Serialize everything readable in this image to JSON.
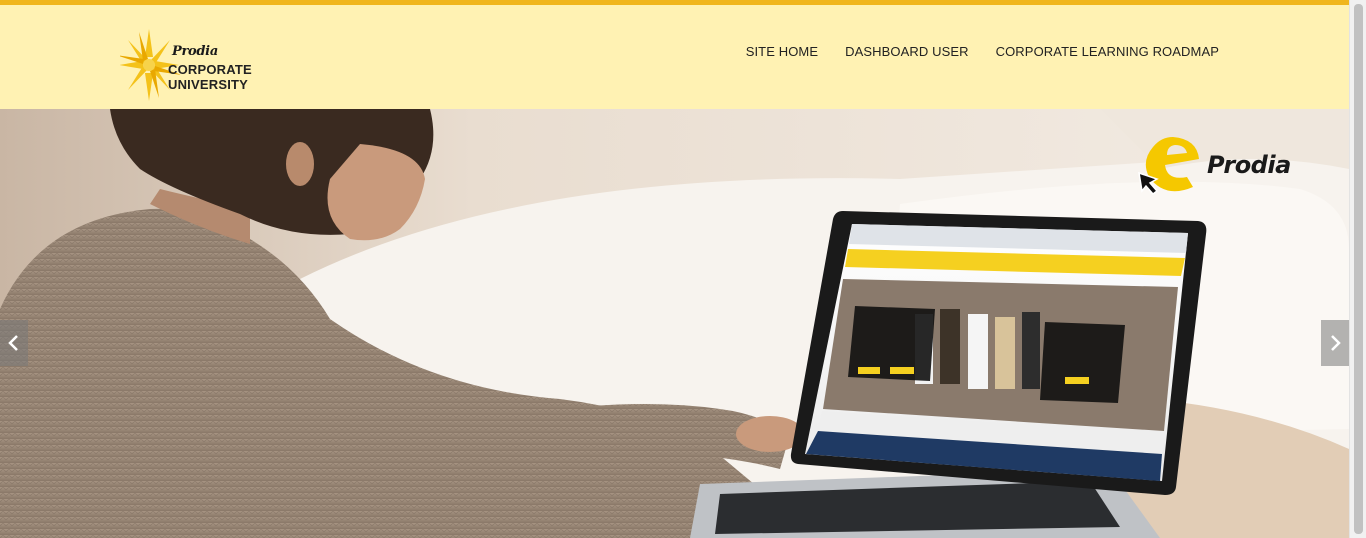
{
  "header": {
    "brand": {
      "prodia": "Prodia",
      "line1": "CORPORATE",
      "line2": "UNIVERSITY"
    },
    "nav": [
      {
        "label": "SITE HOME"
      },
      {
        "label": "DASHBOARD USER"
      },
      {
        "label": "CORPORATE LEARNING ROADMAP"
      }
    ]
  },
  "hero": {
    "logo_text": "Prodia",
    "prev_icon": "chevron-left-icon",
    "next_icon": "chevron-right-icon"
  },
  "colors": {
    "topbar": "#F0B61E",
    "header_bg": "#FFF2B3",
    "brand_yellow": "#F4C21A"
  }
}
